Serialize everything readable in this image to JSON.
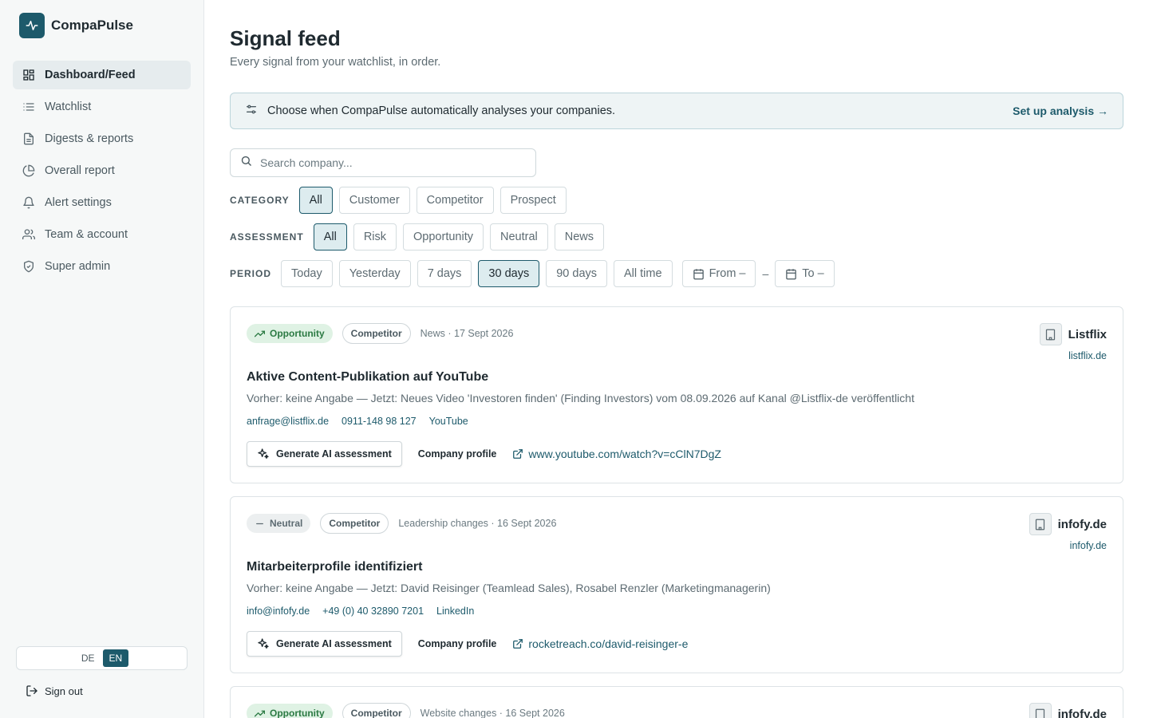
{
  "brand": {
    "name": "CompaPulse"
  },
  "sidebar": {
    "items": [
      {
        "label": "Dashboard/Feed",
        "icon": "dashboard-icon",
        "active": true
      },
      {
        "label": "Watchlist",
        "icon": "list-icon"
      },
      {
        "label": "Digests & reports",
        "icon": "document-icon"
      },
      {
        "label": "Overall report",
        "icon": "pie-chart-icon"
      },
      {
        "label": "Alert settings",
        "icon": "bell-icon"
      },
      {
        "label": "Team & account",
        "icon": "users-icon"
      },
      {
        "label": "Super admin",
        "icon": "shield-icon"
      }
    ],
    "lang": {
      "de": "DE",
      "en": "EN",
      "selected": "EN"
    },
    "signout": "Sign out"
  },
  "main": {
    "title": "Signal feed",
    "subtitle": "Every signal from your watchlist, in order.",
    "banner": {
      "message": "Choose when CompaPulse automatically analyses your companies.",
      "link": "Set up analysis →"
    },
    "search": {
      "placeholder": "Search company..."
    },
    "filters": {
      "category": {
        "label": "CATEGORY",
        "options": [
          "All",
          "Customer",
          "Competitor",
          "Prospect"
        ],
        "selected": "All"
      },
      "assessment": {
        "label": "ASSESSMENT",
        "options": [
          "All",
          "Risk",
          "Opportunity",
          "Neutral",
          "News"
        ],
        "selected": "All"
      },
      "period": {
        "label": "PERIOD",
        "options": [
          "Today",
          "Yesterday",
          "7 days",
          "30 days",
          "90 days",
          "All time"
        ],
        "selected": "30 days",
        "from": "From –",
        "separator": "–",
        "to": "To –"
      }
    },
    "cards": [
      {
        "assessment": "Opportunity",
        "category": "Competitor",
        "meta": "News · 17 Sept 2026",
        "company": "Listflix",
        "domain": "listflix.de",
        "title": "Aktive Content-Publikation auf YouTube",
        "description": "Vorher: keine Angabe — Jetzt: Neues Video 'Investoren finden' (Finding Investors) vom 08.09.2026 auf Kanal @Listflix-de veröffentlicht",
        "email": "anfrage@listflix.de",
        "phone": "0911-148 98 127",
        "source": "YouTube",
        "ai_button": "Generate AI assessment",
        "profile": "Company profile",
        "link": "www.youtube.com/watch?v=cClN7DgZ"
      },
      {
        "assessment": "Neutral",
        "category": "Competitor",
        "meta": "Leadership changes · 16 Sept 2026",
        "company": "infofy.de",
        "domain": "infofy.de",
        "title": "Mitarbeiterprofile identifiziert",
        "description": "Vorher: keine Angabe — Jetzt: David Reisinger (Teamlead Sales), Rosabel Renzler (Marketingmanagerin)",
        "email": "info@infofy.de",
        "phone": "+49 (0) 40 32890 7201",
        "source": "LinkedIn",
        "ai_button": "Generate AI assessment",
        "profile": "Company profile",
        "link": "rocketreach.co/david-reisinger-e"
      },
      {
        "assessment": "Opportunity",
        "category": "Competitor",
        "meta": "Website changes · 16 Sept 2026",
        "company": "infofy.de"
      }
    ]
  },
  "colors": {
    "accent": "#1d5a6b",
    "opportunity": "#2b7a43",
    "sidebar_bg": "#f6f8f8"
  }
}
